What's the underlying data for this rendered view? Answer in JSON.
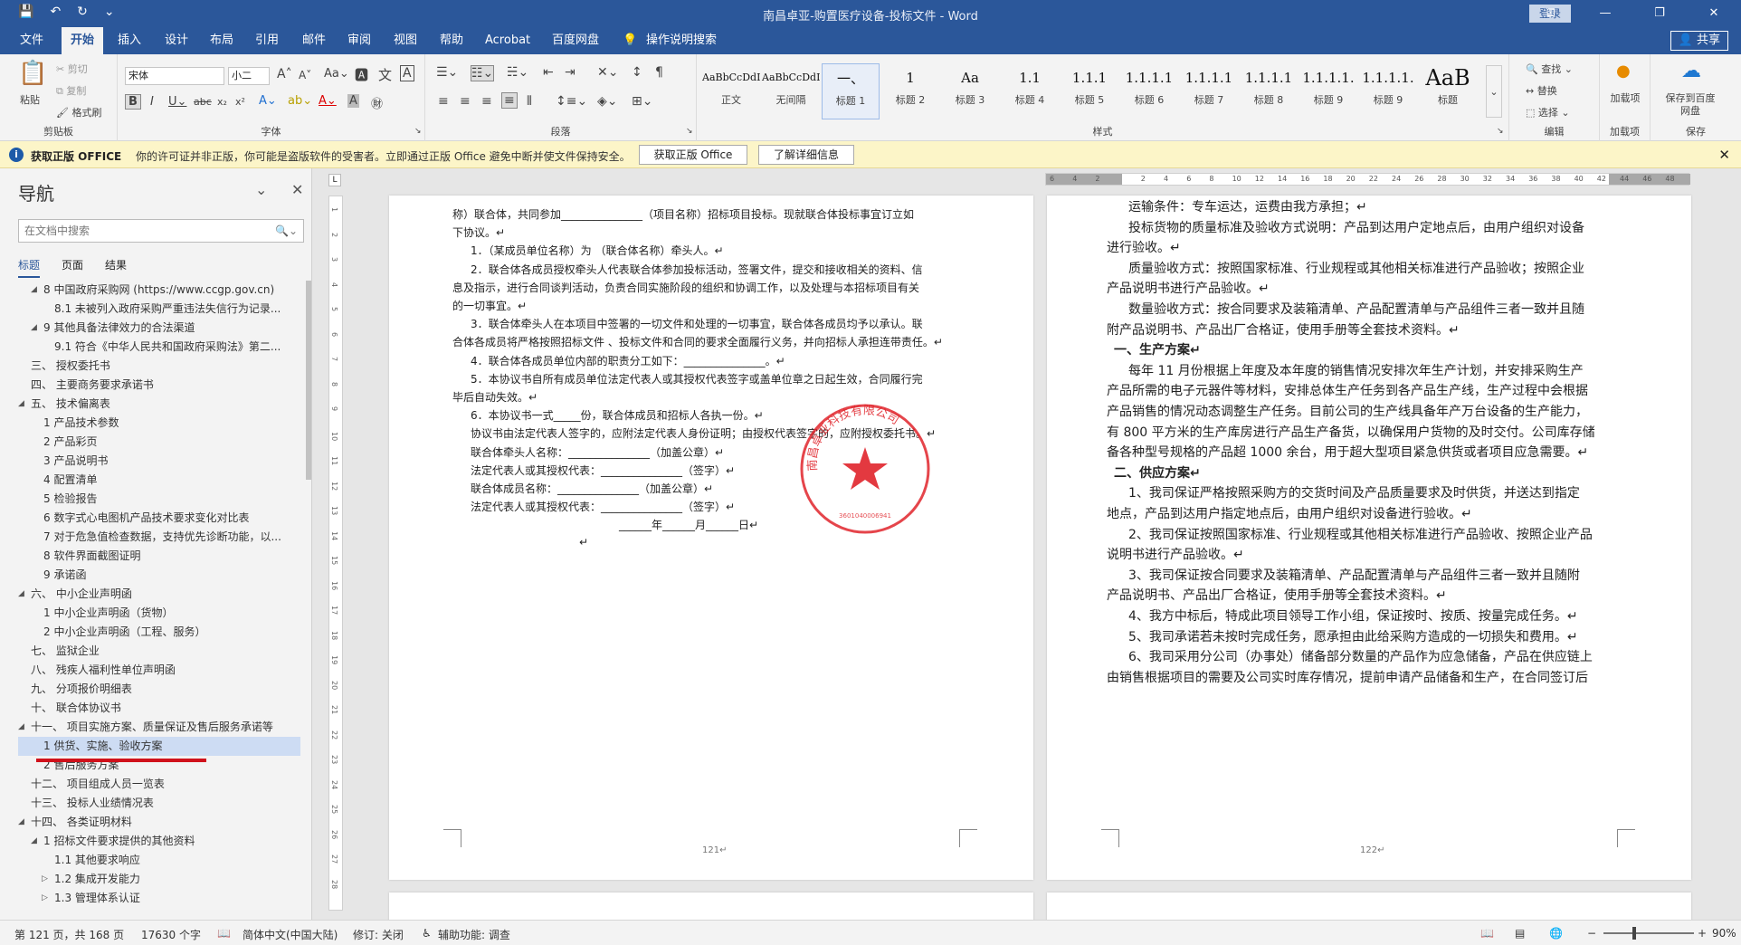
{
  "titlebar": {
    "qat": {
      "save": "💾",
      "undo": "↶",
      "redo": "↻",
      "more": "⌄"
    },
    "title": "南昌卓亚-购置医疗设备-投标文件  -  Word",
    "login": "登录",
    "win": {
      "ribbon_opt": "⊡",
      "minimize": "—",
      "restore": "❐",
      "close": "✕"
    }
  },
  "tabs": [
    "文件",
    "开始",
    "插入",
    "设计",
    "布局",
    "引用",
    "邮件",
    "审阅",
    "视图",
    "帮助",
    "Acrobat",
    "百度网盘"
  ],
  "tell_me": "操作说明搜索",
  "share": "共享",
  "ribbon": {
    "clipboard": {
      "paste": "粘贴",
      "cut": "剪切",
      "copy": "复制",
      "painter": "格式刷",
      "label": "剪贴板"
    },
    "font": {
      "name": "宋体",
      "size": "小二",
      "label": "字体"
    },
    "paragraph": {
      "label": "段落"
    },
    "styles": {
      "label": "样式",
      "items": [
        {
          "preview": "AaBbCcDdI",
          "name": "正文"
        },
        {
          "preview": "AaBbCcDdI",
          "name": "无间隔"
        },
        {
          "preview": "一、",
          "name": "标题 1"
        },
        {
          "preview": "1",
          "name": "标题 2"
        },
        {
          "preview": "Aa",
          "name": "标题 3"
        },
        {
          "preview": "1.1",
          "name": "标题 4"
        },
        {
          "preview": "1.1.1",
          "name": "标题 5"
        },
        {
          "preview": "1.1.1.1",
          "name": "标题 6"
        },
        {
          "preview": "1.1.1.1",
          "name": "标题 7"
        },
        {
          "preview": "1.1.1.1",
          "name": "标题 8"
        },
        {
          "preview": "1.1.1.1.",
          "name": "标题 9"
        },
        {
          "preview": "1.1.1.1.",
          "name": "标题 9"
        },
        {
          "preview": "AaB",
          "name": "标题"
        }
      ]
    },
    "editing": {
      "find": "查找",
      "replace": "替换",
      "select": "选择",
      "label": "编辑"
    },
    "addins": {
      "name": "加载项",
      "label": "加载项"
    },
    "save": {
      "name": "保存到百度网盘",
      "label": "保存"
    }
  },
  "msgbar": {
    "title": "获取正版 OFFICE",
    "text": "你的许可证并非正版，你可能是盗版软件的受害者。立即通过正版 Office 避免中断并使文件保持安全。",
    "btn1": "获取正版 Office",
    "btn2": "了解详细信息"
  },
  "nav": {
    "title": "导航",
    "search_placeholder": "在文档中搜索",
    "tabs": [
      "标题",
      "页面",
      "结果"
    ],
    "items": [
      {
        "text": "8 中国政府采购网 (https://www.ccgp.gov.cn)",
        "level": 1,
        "toggle": "◢"
      },
      {
        "text": "8.1 未被列入政府采购严重违法失信行为记录...",
        "level": 2,
        "toggle": ""
      },
      {
        "text": "9 其他具备法律效力的合法渠道",
        "level": 1,
        "toggle": "◢"
      },
      {
        "text": "9.1 符合《中华人民共和国政府采购法》第二...",
        "level": 2,
        "toggle": ""
      },
      {
        "text": "三、 授权委托书",
        "level": 0,
        "toggle": ""
      },
      {
        "text": "四、 主要商务要求承诺书",
        "level": 0,
        "toggle": ""
      },
      {
        "text": "五、 技术偏离表",
        "level": 0,
        "toggle": "◢"
      },
      {
        "text": "1 产品技术参数",
        "level": 1,
        "toggle": ""
      },
      {
        "text": "2 产品彩页",
        "level": 1,
        "toggle": ""
      },
      {
        "text": "3 产品说明书",
        "level": 1,
        "toggle": ""
      },
      {
        "text": "4 配置清单",
        "level": 1,
        "toggle": ""
      },
      {
        "text": "5 检验报告",
        "level": 1,
        "toggle": ""
      },
      {
        "text": "6 数字式心电图机产品技术要求变化对比表",
        "level": 1,
        "toggle": ""
      },
      {
        "text": "7 对于危急值检查数据，支持优先诊断功能，以...",
        "level": 1,
        "toggle": ""
      },
      {
        "text": "8 软件界面截图证明",
        "level": 1,
        "toggle": ""
      },
      {
        "text": "9 承诺函",
        "level": 1,
        "toggle": ""
      },
      {
        "text": "六、 中小企业声明函",
        "level": 0,
        "toggle": "◢"
      },
      {
        "text": "1 中小企业声明函（货物）",
        "level": 1,
        "toggle": ""
      },
      {
        "text": "2 中小企业声明函（工程、服务）",
        "level": 1,
        "toggle": ""
      },
      {
        "text": "七、 监狱企业",
        "level": 0,
        "toggle": ""
      },
      {
        "text": "八、 残疾人福利性单位声明函",
        "level": 0,
        "toggle": ""
      },
      {
        "text": "九、 分项报价明细表",
        "level": 0,
        "toggle": ""
      },
      {
        "text": "十、 联合体协议书",
        "level": 0,
        "toggle": ""
      },
      {
        "text": "十一、 项目实施方案、质量保证及售后服务承诺等",
        "level": 0,
        "toggle": "◢"
      },
      {
        "text": "1 供货、实施、验收方案",
        "level": 1,
        "toggle": "",
        "selected": true
      },
      {
        "text": "2 售后服务方案",
        "level": 1,
        "toggle": ""
      },
      {
        "text": "十二、 项目组成人员一览表",
        "level": 0,
        "toggle": ""
      },
      {
        "text": "十三、 投标人业绩情况表",
        "level": 0,
        "toggle": ""
      },
      {
        "text": "十四、 各类证明材料",
        "level": 0,
        "toggle": "◢"
      },
      {
        "text": "1 招标文件要求提供的其他资料",
        "level": 1,
        "toggle": "◢"
      },
      {
        "text": "1.1 其他要求响应",
        "level": 2,
        "toggle": ""
      },
      {
        "text": "1.2 集成开发能力",
        "level": 2,
        "toggle": "▷"
      },
      {
        "text": "1.3 管理体系认证",
        "level": 2,
        "toggle": "▷"
      }
    ]
  },
  "ruler": {
    "h": [
      "6",
      "4",
      "2",
      "",
      "2",
      "4",
      "6",
      "8",
      "10",
      "12",
      "14",
      "16",
      "18",
      "20",
      "22",
      "24",
      "26",
      "28",
      "30",
      "32",
      "34",
      "36",
      "38",
      "40",
      "42",
      "44",
      "46",
      "48"
    ],
    "v": [
      "1",
      "2",
      "3",
      "4",
      "5",
      "6",
      "7",
      "8",
      "9",
      "10",
      "11",
      "12",
      "13",
      "14",
      "15",
      "16",
      "17",
      "18",
      "19",
      "20",
      "21",
      "22",
      "23",
      "24",
      "25",
      "26",
      "27",
      "28"
    ]
  },
  "page1": {
    "lines": [
      "称）联合体，共同参加_______________（项目名称）招标项目投标。现就联合体投标事宜订立如",
      "下协议。↵",
      "1．（某成员单位名称）为 （联合体名称）牵头人。↵",
      "2．联合体各成员授权牵头人代表联合体参加投标活动，签署文件，提交和接收相关的资料、信",
      "息及指示，进行合同谈判活动，负责合同实施阶段的组织和协调工作，以及处理与本招标项目有关",
      "的一切事宜。↵",
      "3．联合体牵头人在本项目中签署的一切文件和处理的一切事宜，联合体各成员均予以承认。联",
      "合体各成员将严格按照招标文件 、投标文件和合同的要求全面履行义务，并向招标人承担连带责任。↵",
      "4．联合体各成员单位内部的职责分工如下：_______________。↵",
      "5．本协议书自所有成员单位法定代表人或其授权代表签字或盖单位章之日起生效，合同履行完",
      "毕后自动失效。↵",
      "6．本协议书一式_____份，联合体成员和招标人各执一份。↵",
      "协议书由法定代表人签字的，应附法定代表人身份证明；由授权代表签字的，应附授权委托书。↵",
      "联合体牵头人名称：_______________（加盖公章）↵",
      "法定代表人或其授权代表：_______________（签字）↵",
      "联合体成员名称：_______________（加盖公章）↵",
      "法定代表人或其授权代表：_______________（签字）↵",
      "______年______月______日↵",
      "↵"
    ],
    "page_number": "121↵"
  },
  "page2": {
    "lines": [
      "运输条件：专车运达，运费由我方承担；↵",
      "投标货物的质量标准及验收方式说明：产品到达用户定地点后，由用户组织对设备",
      "进行验收。↵",
      "质量验收方式：按照国家标准、行业规程或其他相关标准进行产品验收；按照企业",
      "产品说明书进行产品验收。↵",
      "数量验收方式：按合同要求及装箱清单、产品配置清单与产品组件三者一致并且随",
      "附产品说明书、产品出厂合格证，使用手册等全套技术资料。↵",
      "一、生产方案↵",
      "每年 11 月份根据上年度及本年度的销售情况安排次年生产计划，并安排采购生产",
      "产品所需的电子元器件等材料，安排总体生产任务到各产品生产线，生产过程中会根据",
      "产品销售的情况动态调整生产任务。目前公司的生产线具备年产万台设备的生产能力，",
      "有 800 平方米的生产库房进行产品生产备货，以确保用户货物的及时交付。公司库存储",
      "备各种型号规格的产品超 1000 余台，用于超大型项目紧急供货或者项目应急需要。↵",
      "二、供应方案↵",
      "1、我司保证严格按照采购方的交货时间及产品质量要求及时供货，并送达到指定",
      "地点，产品到达用户指定地点后，由用户组织对设备进行验收。↵",
      "2、我司保证按照国家标准、行业规程或其他相关标准进行产品验收、按照企业产品",
      "说明书进行产品验收。↵",
      "3、我司保证按合同要求及装箱清单、产品配置清单与产品组件三者一致并且随附",
      "产品说明书、产品出厂合格证，使用手册等全套技术资料。↵",
      "4、我方中标后，特成此项目领导工作小组，保证按时、按质、按量完成任务。↵",
      "5、我司承诺若未按时完成任务，愿承担由此给采购方造成的一切损失和费用。↵",
      "6、我司采用分公司（办事处）储备部分数量的产品作为应急储备，产品在供应链上",
      "由销售根据项目的需要及公司实时库存情况，提前申请产品储备和生产，在合同签订后"
    ],
    "page_number": "122↵"
  },
  "seal": {
    "text": "南昌卓亚科技有限公司",
    "code": "3601040006941"
  },
  "status": {
    "page": "第 121 页，共 168 页",
    "words": "17630 个字",
    "lang": "简体中文(中国大陆)",
    "track": "修订: 关闭",
    "access": "辅助功能: 调查",
    "zoom": "90%"
  },
  "colors": {
    "accent": "#2b579a",
    "selection": "#cddcf3",
    "underline_red": "#d0111b",
    "seal": "#e0242b"
  }
}
